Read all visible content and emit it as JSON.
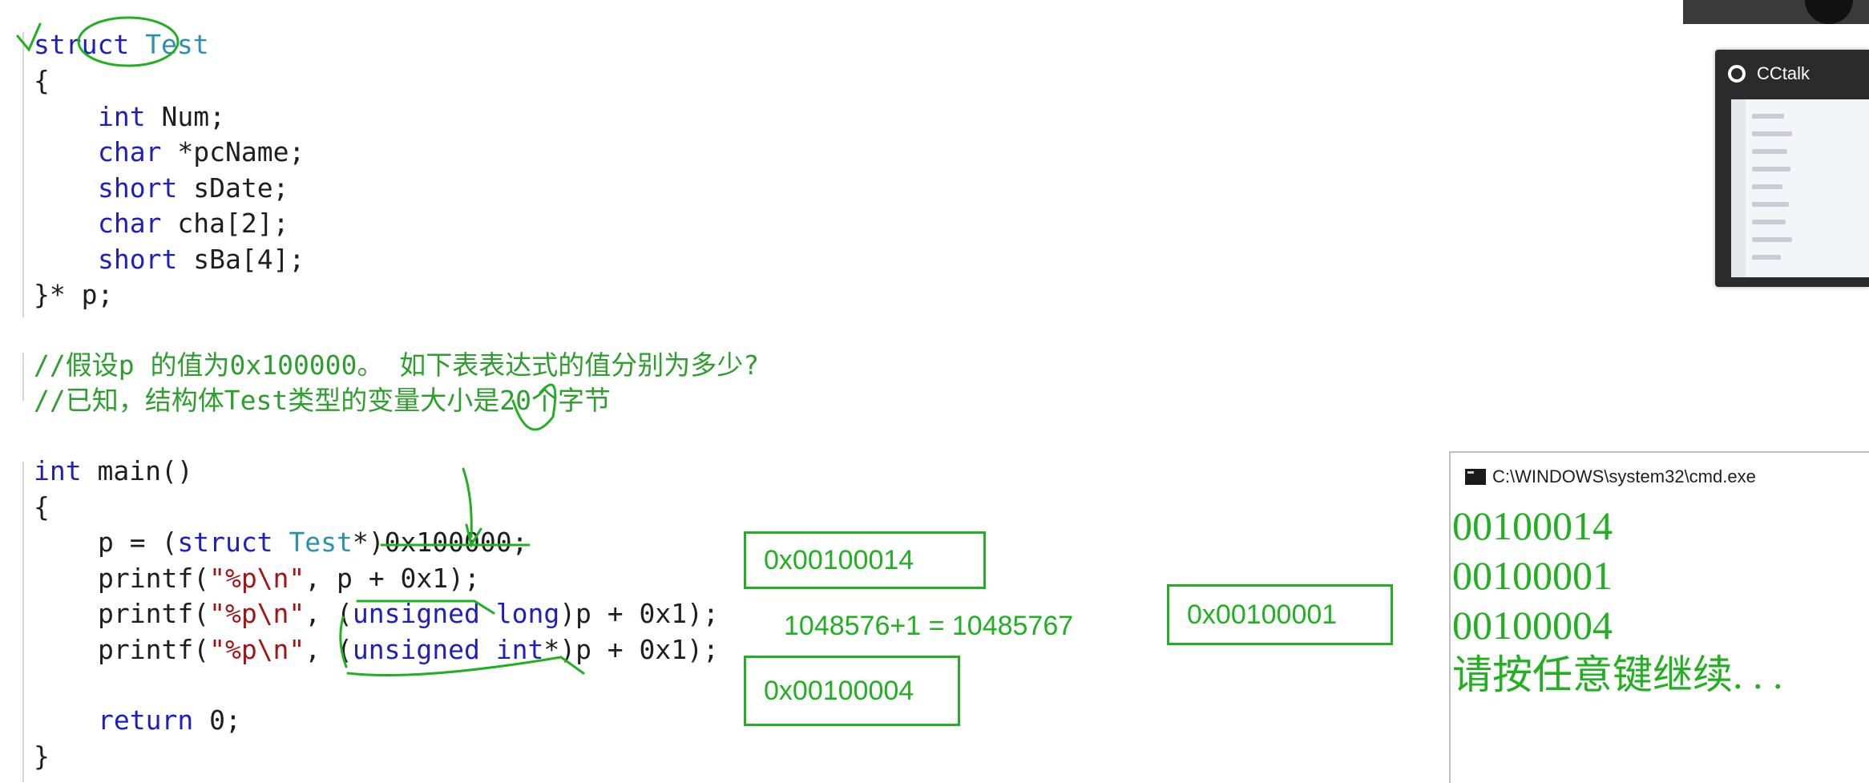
{
  "code": {
    "struct_keyword": "struct",
    "struct_name": "Test",
    "open_brace": "{",
    "fields": [
      {
        "type": "int",
        "name": "Num;"
      },
      {
        "type": "char",
        "name": "*pcName;"
      },
      {
        "type": "short",
        "name": "sDate;"
      },
      {
        "type": "char",
        "name": "cha[2];"
      },
      {
        "type": "short",
        "name": "sBa[4];"
      }
    ],
    "struct_close": "}* p;",
    "comment1": "//假设p 的值为0x100000。 如下表表达式的值分别为多少?",
    "comment2": "//已知，结构体Test类型的变量大小是20个字节",
    "main_kw": "int",
    "main_sig": "main()",
    "main_open": "{",
    "assign": {
      "pre": "p = (",
      "kw": "struct",
      "ty": "Test",
      "post": "*)0x100000;"
    },
    "printf1": {
      "pre": "printf(",
      "str": "\"%p\\n\"",
      "post": ", p + 0x1);"
    },
    "printf2": {
      "pre": "printf(",
      "str": "\"%p\\n\"",
      "mid": ", (",
      "kw": "unsigned long",
      "post": ")p + 0x1);"
    },
    "printf3": {
      "pre": "printf(",
      "str": "\"%p\\n\"",
      "mid": ", (",
      "kw": "unsigned int",
      "post": "*)p + 0x1);"
    },
    "return_kw": "return",
    "return_val": "0;",
    "main_close": "}"
  },
  "annotations": {
    "box1": "0x00100014",
    "box2": "0x00100004",
    "box3": "0x00100001",
    "calc": "1048576+1 = 10485767"
  },
  "cmd": {
    "title": "C:\\WINDOWS\\system32\\cmd.exe",
    "output": [
      "00100014",
      "00100001",
      "00100004",
      "请按任意键继续. . ."
    ]
  },
  "cctalk": {
    "title": "CCtalk"
  },
  "colors": {
    "keyword": "#1f1fbf",
    "type": "#2b91af",
    "string": "#a31515",
    "comment": "#2e9e2e",
    "annotation": "#22b022"
  }
}
